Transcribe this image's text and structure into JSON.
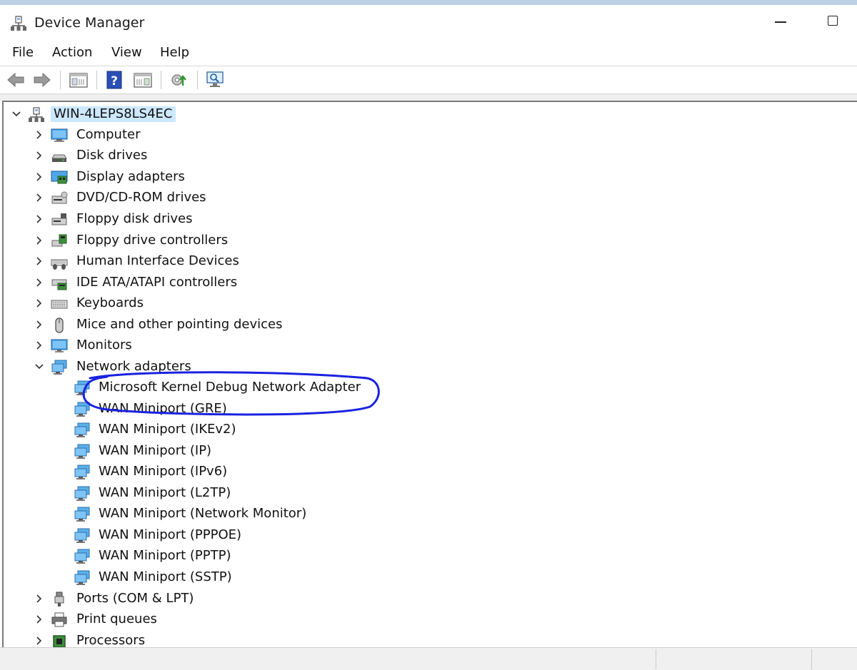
{
  "window": {
    "title": "Device Manager"
  },
  "menu": {
    "items": [
      "File",
      "Action",
      "View",
      "Help"
    ]
  },
  "toolbar": {
    "buttons": [
      "back-arrow-icon",
      "forward-arrow-icon",
      "show-hide-console-tree-icon",
      "help-icon",
      "properties-pane-icon",
      "update-driver-icon",
      "scan-hardware-icon"
    ]
  },
  "tree": {
    "root": "WIN-4LEPS8LS4EC",
    "categories": {
      "computer": "Computer",
      "disk": "Disk drives",
      "display": "Display adapters",
      "dvd": "DVD/CD-ROM drives",
      "floppy": "Floppy disk drives",
      "floppyctl": "Floppy drive controllers",
      "hid": "Human Interface Devices",
      "ide": "IDE ATA/ATAPI controllers",
      "keyboards": "Keyboards",
      "mice": "Mice and other pointing devices",
      "monitors": "Monitors",
      "network": "Network adapters",
      "ports": "Ports (COM & LPT)",
      "print": "Print queues",
      "processors": "Processors"
    },
    "network_children": [
      "Microsoft Kernel Debug Network Adapter",
      "WAN Miniport (GRE)",
      "WAN Miniport (IKEv2)",
      "WAN Miniport (IP)",
      "WAN Miniport (IPv6)",
      "WAN Miniport (L2TP)",
      "WAN Miniport (Network Monitor)",
      "WAN Miniport (PPPOE)",
      "WAN Miniport (PPTP)",
      "WAN Miniport (SSTP)"
    ]
  },
  "colors": {
    "selection": "#cce8ff",
    "annotation_ink": "#1a22e0"
  }
}
